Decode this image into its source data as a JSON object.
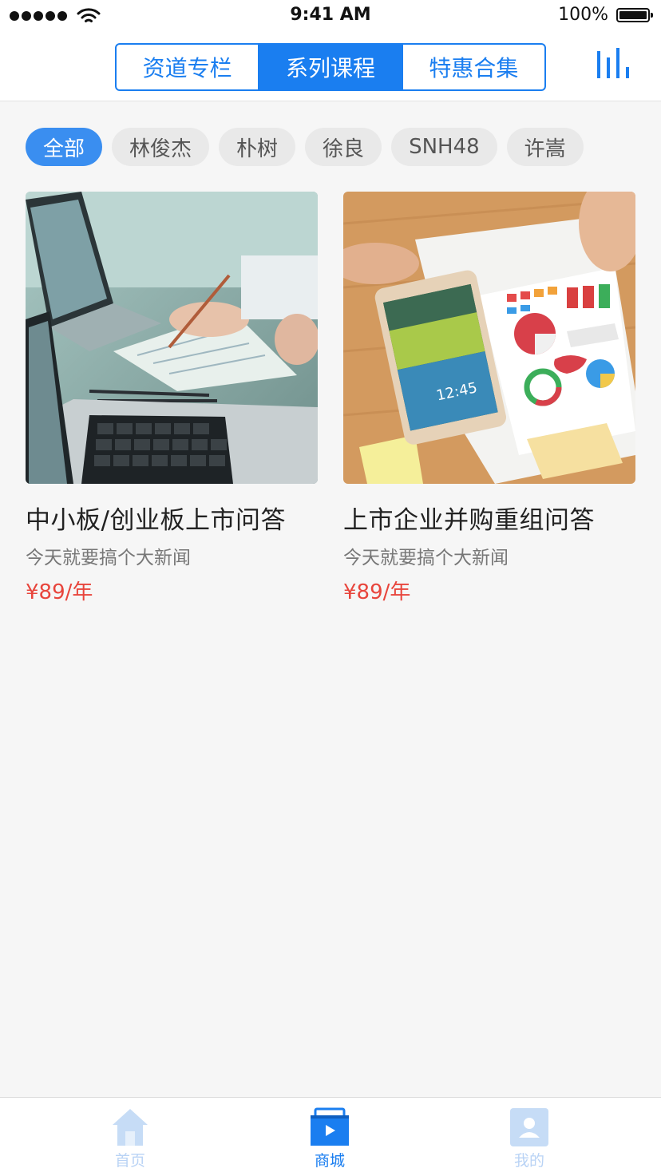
{
  "status_bar": {
    "time": "9:41 AM",
    "battery": "100%"
  },
  "header": {
    "segments": [
      {
        "label": "资道专栏",
        "active": false
      },
      {
        "label": "系列课程",
        "active": true
      },
      {
        "label": "特惠合集",
        "active": false
      }
    ],
    "right_icon": "bar-chart-icon"
  },
  "filters": [
    {
      "label": "全部",
      "active": true
    },
    {
      "label": "林俊杰",
      "active": false
    },
    {
      "label": "朴树",
      "active": false
    },
    {
      "label": "徐良",
      "active": false
    },
    {
      "label": "SNH48",
      "active": false
    },
    {
      "label": "许嵩",
      "active": false
    }
  ],
  "courses": [
    {
      "title": "中小板/创业板上市问答",
      "subtitle": "今天就要搞个大新闻",
      "price": "¥89/年",
      "image": "laptop-desk-photo"
    },
    {
      "title": "上市企业并购重组问答",
      "subtitle": "今天就要搞个大新闻",
      "price": "¥89/年",
      "image": "tablet-charts-photo"
    }
  ],
  "tabbar": [
    {
      "label": "首页",
      "icon": "home-icon",
      "active": false
    },
    {
      "label": "商城",
      "icon": "store-play-icon",
      "active": true
    },
    {
      "label": "我的",
      "icon": "profile-icon",
      "active": false
    }
  ],
  "colors": {
    "accent": "#1a7ef0",
    "chip_active": "#3a8ef0",
    "price": "#e8453c",
    "background": "#f6f6f6"
  }
}
